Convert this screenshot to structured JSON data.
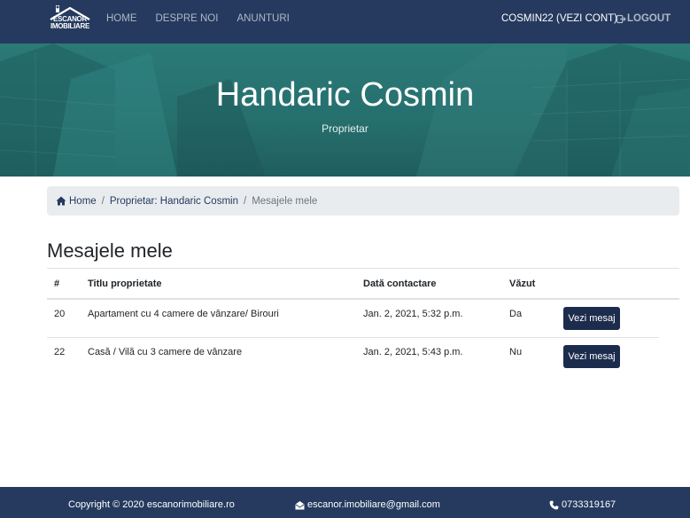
{
  "navbar": {
    "logo_text_line1": "ESCANOR",
    "logo_text_line2": "IMOBILIARE",
    "links": [
      "HOME",
      "DESPRE NOI",
      "ANUNTURI"
    ],
    "account_label": "COSMIN22 (VEZI CONT)",
    "logout_label": "LOGOUT",
    "logout_icon": "sign-out-icon"
  },
  "hero": {
    "title": "Handaric Cosmin",
    "subtitle": "Proprietar"
  },
  "breadcrumb": {
    "items": [
      "Home",
      "Proprietar: Handaric Cosmin",
      "Mesajele mele"
    ],
    "home_icon": "home-icon"
  },
  "page_title": "Mesajele mele",
  "table": {
    "headers": [
      "#",
      "Titlu proprietate",
      "Dată contactare",
      "Văzut",
      ""
    ],
    "rows": [
      {
        "id": "20",
        "title": "Apartament cu 4 camere de vânzare/ Birouri",
        "date": "Jan. 2, 2021, 5:32 p.m.",
        "seen": "Da",
        "action": "Vezi mesaj"
      },
      {
        "id": "22",
        "title": "Casă / Vilă cu 3 camere de vânzare",
        "date": "Jan. 2, 2021, 5:43 p.m.",
        "seen": "Nu",
        "action": "Vezi mesaj"
      }
    ]
  },
  "footer": {
    "copyright": "Copyright © 2020 escanorimobiliare.ro",
    "email": "escanor.imobiliare@gmail.com",
    "phone": "0733319167",
    "email_icon": "envelope-open-icon",
    "phone_icon": "phone-icon"
  },
  "colors": {
    "navbar": "#253a5e",
    "hero": "#2a7a78",
    "button": "#1c2c4d",
    "breadcrumb_bg": "#e9ecef"
  }
}
